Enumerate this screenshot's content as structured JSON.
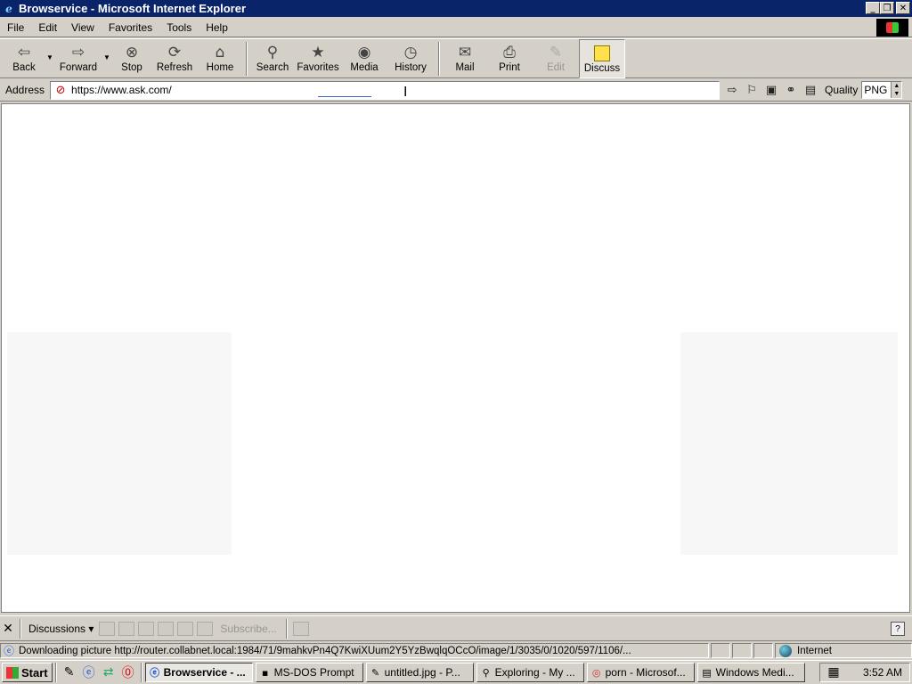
{
  "window": {
    "title": "Browservice - Microsoft Internet Explorer",
    "controls": {
      "minimize": "_",
      "restore": "❐",
      "close": "✕"
    }
  },
  "menu": [
    "File",
    "Edit",
    "View",
    "Favorites",
    "Tools",
    "Help"
  ],
  "toolbar": {
    "back": "Back",
    "forward": "Forward",
    "stop": "Stop",
    "refresh": "Refresh",
    "home": "Home",
    "search": "Search",
    "favorites": "Favorites",
    "media": "Media",
    "history": "History",
    "mail": "Mail",
    "print": "Print",
    "edit": "Edit",
    "discuss": "Discuss"
  },
  "address": {
    "label": "Address",
    "url": "https://www.ask.com/"
  },
  "quality": {
    "label": "Quality",
    "value": "PNG"
  },
  "discussions": {
    "label": "Discussions ▾",
    "subscribe": "Subscribe..."
  },
  "status": {
    "text": "Downloading picture http://router.collabnet.local:1984/71/9mahkvPn4Q7KwiXUum2Y5YzBwqlqOCcO/image/1/3035/0/1020/597/1106/...",
    "zone": "Internet"
  },
  "taskbar": {
    "start": "Start",
    "tasks": [
      {
        "label": "Browservice - ...",
        "active": true
      },
      {
        "label": "MS-DOS Prompt",
        "active": false
      },
      {
        "label": "untitled.jpg - P...",
        "active": false
      },
      {
        "label": "Exploring - My ...",
        "active": false
      },
      {
        "label": "porn - Microsof...",
        "active": false
      },
      {
        "label": "Windows Medi...",
        "active": false
      }
    ],
    "clock": "3:52 AM"
  },
  "colors": {
    "titlebar": "#0a246a",
    "chrome": "#d4d0c8",
    "content": "#ffffff"
  }
}
